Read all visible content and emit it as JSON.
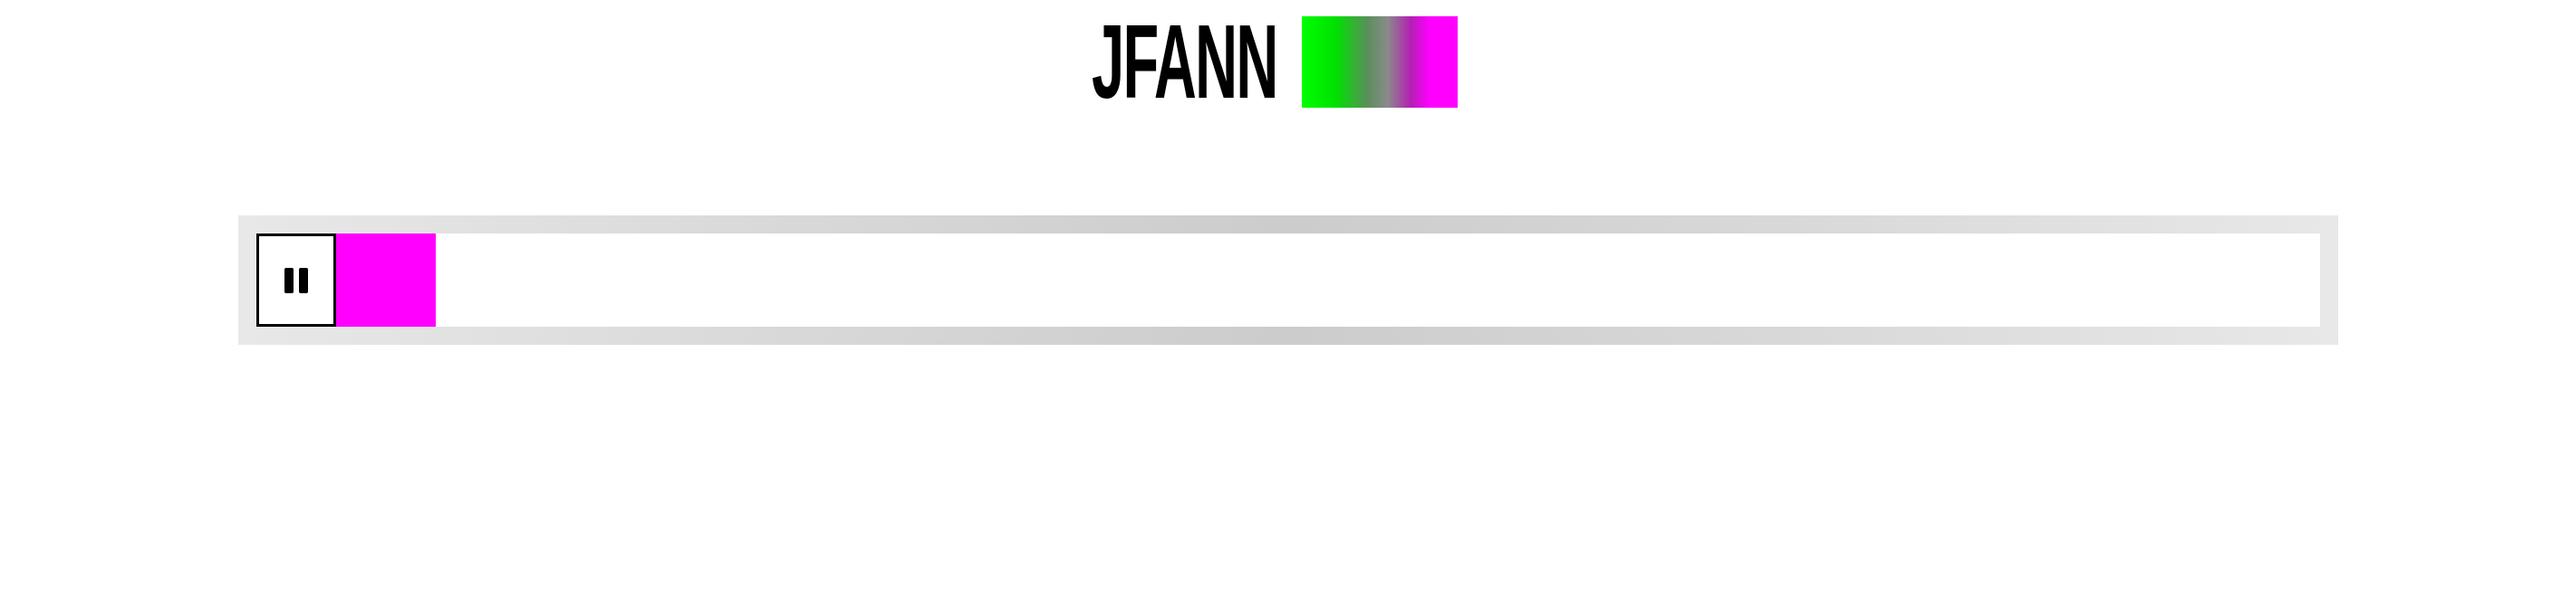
{
  "logo": {
    "text": "JFANN"
  },
  "player": {
    "state": "playing",
    "pause_icon": "pause-icon",
    "progress_fraction": 0.05,
    "progress_color": "#ff00ff"
  },
  "colors": {
    "logo_gradient_start": "#00ff00",
    "logo_gradient_end": "#ff00ff",
    "frame": "#cccccc",
    "text": "#000000"
  }
}
